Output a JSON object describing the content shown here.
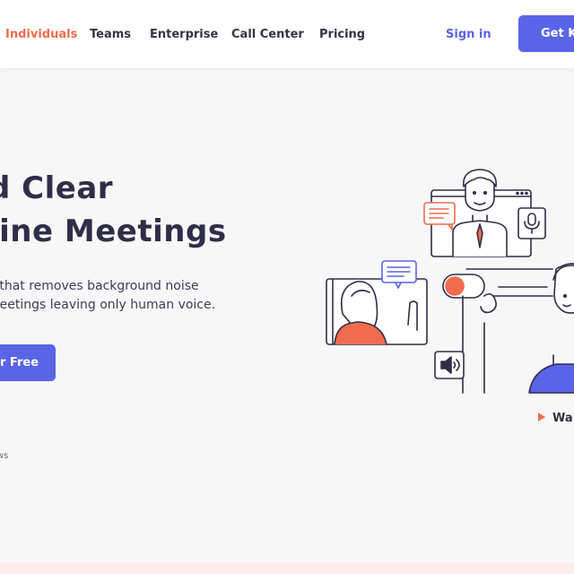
{
  "nav": {
    "items": [
      "Individuals",
      "Teams",
      "Enterprise",
      "Call Center",
      "Pricing"
    ],
    "signin": "Sign in",
    "cta": "Get Krisp"
  },
  "hero": {
    "headline_line1": "d Clear",
    "headline_line2": "line Meetings",
    "sub_line1": "p that removes background noise",
    "sub_line2": "meetings leaving only human voice.",
    "cta": "r Free",
    "small_text": "ws",
    "watch": "Wa"
  },
  "colors": {
    "accent": "#5a64e6",
    "orange": "#f26b4f",
    "text": "#2e2e48"
  }
}
